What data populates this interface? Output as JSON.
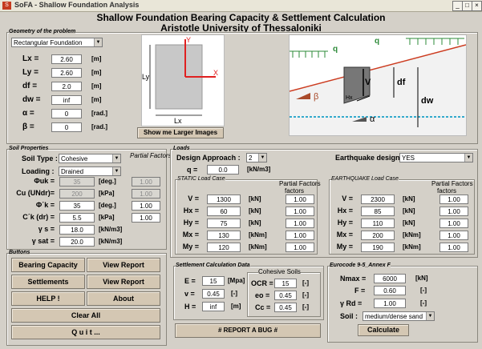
{
  "window": {
    "title": "SoFA - Shallow Foundation Analysis",
    "icon": "app-icon"
  },
  "header": {
    "line1": "Shallow Foundation Bearing Capacity & Settlement Calculation",
    "line2": "Aristotle University of Thessaloniki"
  },
  "geometry": {
    "title": "Geometry of the problem",
    "foundation_type": "Rectangular Foundation",
    "rows": [
      {
        "label": "Lx =",
        "value": "2.60",
        "unit": "[m]"
      },
      {
        "label": "Ly =",
        "value": "2.60",
        "unit": "[m]"
      },
      {
        "label": "df =",
        "value": "2.0",
        "unit": "[m]"
      },
      {
        "label": "dw =",
        "value": "inf",
        "unit": "[m]"
      },
      {
        "label": "α =",
        "value": "0",
        "unit": "[rad.]"
      },
      {
        "label": "β =",
        "value": "0",
        "unit": "[rad.]"
      }
    ],
    "show_images_button": "Show me Larger Images",
    "fig1": {
      "ly": "Ly",
      "lx": "Lx",
      "y": "Y",
      "x": "X"
    },
    "fig2": {
      "q1": "q",
      "q2": "q",
      "v": "V",
      "df": "df",
      "dw": "dw",
      "hx": "Hx",
      "beta": "β",
      "alpha": "α"
    }
  },
  "soil": {
    "title": "Soil Properties",
    "type_label": "Soil Type :",
    "type_value": "Cohesive",
    "loading_label": "Loading :",
    "loading_value": "Drained",
    "partial_header": "Partial Factors",
    "rows": [
      {
        "label": "Φuk =",
        "value": "35",
        "unit": "[deg.]",
        "pf": "1.00",
        "disabled": true
      },
      {
        "label": "Cu (UNdr)=",
        "value": "200",
        "unit": "[kPa]",
        "pf": "1.00",
        "disabled": true
      },
      {
        "label": "Φ΄k =",
        "value": "35",
        "unit": "[deg.]",
        "pf": "1.00",
        "disabled": false
      },
      {
        "label": "C΄k (dr) =",
        "value": "5.5",
        "unit": "[kPa]",
        "pf": "1.00",
        "disabled": false
      },
      {
        "label": "γ s =",
        "value": "18.0",
        "unit": "[kN/m3]",
        "pf": "",
        "disabled": false
      },
      {
        "label": "γ sat =",
        "value": "20.0",
        "unit": "[kN/m3]",
        "pf": "",
        "disabled": false
      }
    ]
  },
  "loads": {
    "title": "Loads",
    "design_approach_label": "Design Approach :",
    "design_approach_value": "2",
    "q_label": "q =",
    "q_value": "0.0",
    "q_unit": "[kN/m3]",
    "eq_label": "Earthquake design :",
    "eq_value": "YES",
    "static": {
      "title": "STATIC Load Case",
      "pf_header": "Partial Factors",
      "pf_header2": "factors",
      "rows": [
        {
          "label": "V =",
          "value": "1300",
          "unit": "[kN]",
          "pf": "1.00"
        },
        {
          "label": "Hx =",
          "value": "60",
          "unit": "[kN]",
          "pf": "1.00"
        },
        {
          "label": "Hy =",
          "value": "75",
          "unit": "[kN]",
          "pf": "1.00"
        },
        {
          "label": "Mx =",
          "value": "130",
          "unit": "[kNm]",
          "pf": "1.00"
        },
        {
          "label": "My =",
          "value": "120",
          "unit": "[kNm]",
          "pf": "1.00"
        }
      ]
    },
    "eq": {
      "title": "EARTHQUAKE Load Case",
      "pf_header": "Partial Factors",
      "pf_header2": "factors",
      "rows": [
        {
          "label": "V =",
          "value": "2300",
          "unit": "[kN]",
          "pf": "1.00"
        },
        {
          "label": "Hx =",
          "value": "85",
          "unit": "[kN]",
          "pf": "1.00"
        },
        {
          "label": "Hy =",
          "value": "110",
          "unit": "[kN]",
          "pf": "1.00"
        },
        {
          "label": "Mx =",
          "value": "200",
          "unit": "[kNm]",
          "pf": "1.00"
        },
        {
          "label": "My =",
          "value": "190",
          "unit": "[kNm]",
          "pf": "1.00"
        }
      ]
    }
  },
  "buttons": {
    "title": "Buttons",
    "bearing": "Bearing Capacity",
    "view_report1": "View Report",
    "settlements": "Settlements",
    "view_report2": "View Report",
    "help": "HELP !",
    "about": "About",
    "clear": "Clear All",
    "quit": "Q u i t ..."
  },
  "settlement": {
    "title": "Settlement Calculation Data",
    "e_label": "E =",
    "e_value": "15",
    "e_unit": "[Mpa]",
    "v_label": "v =",
    "v_value": "0.45",
    "v_unit": "[-]",
    "h_label": "H =",
    "h_value": "inf",
    "h_unit": "[m]",
    "cohesive_title": "Cohesive Soils",
    "ocr_label": "OCR =",
    "ocr_value": "15",
    "ocr_unit": "[-]",
    "eo_label": "eo =",
    "eo_value": "0.45",
    "eo_unit": "[-]",
    "cc_label": "Cc =",
    "cc_value": "0.45",
    "cc_unit": "[-]"
  },
  "report_bug": "# REPORT A BUG #",
  "eurocode": {
    "title": "Eurocode 9-5_Annex F",
    "nmax_label": "Nmax =",
    "nmax_value": "6000",
    "nmax_unit": "[kN]",
    "f_label": "F =",
    "f_value": "0.60",
    "f_unit": "[-]",
    "rd_label": "γ  Rd =",
    "rd_value": "1.00",
    "rd_unit": "[-]",
    "soil_label": "Soil :",
    "soil_value": "medium/dense sand",
    "calc": "Calculate"
  },
  "colors": {
    "accent": "#d4c7b3",
    "bg": "#d4d0c8",
    "arrow_green": "#2e8b3a",
    "red_axis": "#e02020"
  }
}
